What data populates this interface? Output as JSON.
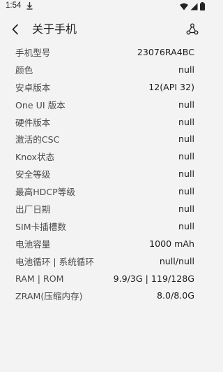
{
  "status_bar": {
    "time": "1:54"
  },
  "app_bar": {
    "title": "关于手机"
  },
  "info_rows": [
    {
      "label": "手机型号",
      "value": "23076RA4BC"
    },
    {
      "label": "颜色",
      "value": "null"
    },
    {
      "label": "安卓版本",
      "value": "12(API 32)"
    },
    {
      "label": "One UI 版本",
      "value": "null"
    },
    {
      "label": "硬件版本",
      "value": "null"
    },
    {
      "label": "激活的CSC",
      "value": "null"
    },
    {
      "label": "Knox状态",
      "value": "null"
    },
    {
      "label": "安全等级",
      "value": "null"
    },
    {
      "label": "最高HDCP等级",
      "value": "null"
    },
    {
      "label": "出厂日期",
      "value": "null"
    },
    {
      "label": "SIM卡插槽数",
      "value": "null"
    },
    {
      "label": "电池容量",
      "value": "1000 mAh"
    },
    {
      "label": "电池循环 | 系统循环",
      "value": "null/null"
    },
    {
      "label": "RAM | ROM",
      "value": "9.9/3G | 119/128G"
    },
    {
      "label": "ZRAM(压缩内存)",
      "value": "8.0/8.0G"
    }
  ],
  "icons": {
    "download": "download-icon",
    "wifi": "wifi-icon",
    "signal": "signal-icon",
    "battery": "battery-icon",
    "back": "back-arrow-icon",
    "share": "share-icon"
  },
  "colors": {
    "background": "#f3f3f3",
    "label": "#4a4a4a",
    "value": "#1c1c1c"
  }
}
